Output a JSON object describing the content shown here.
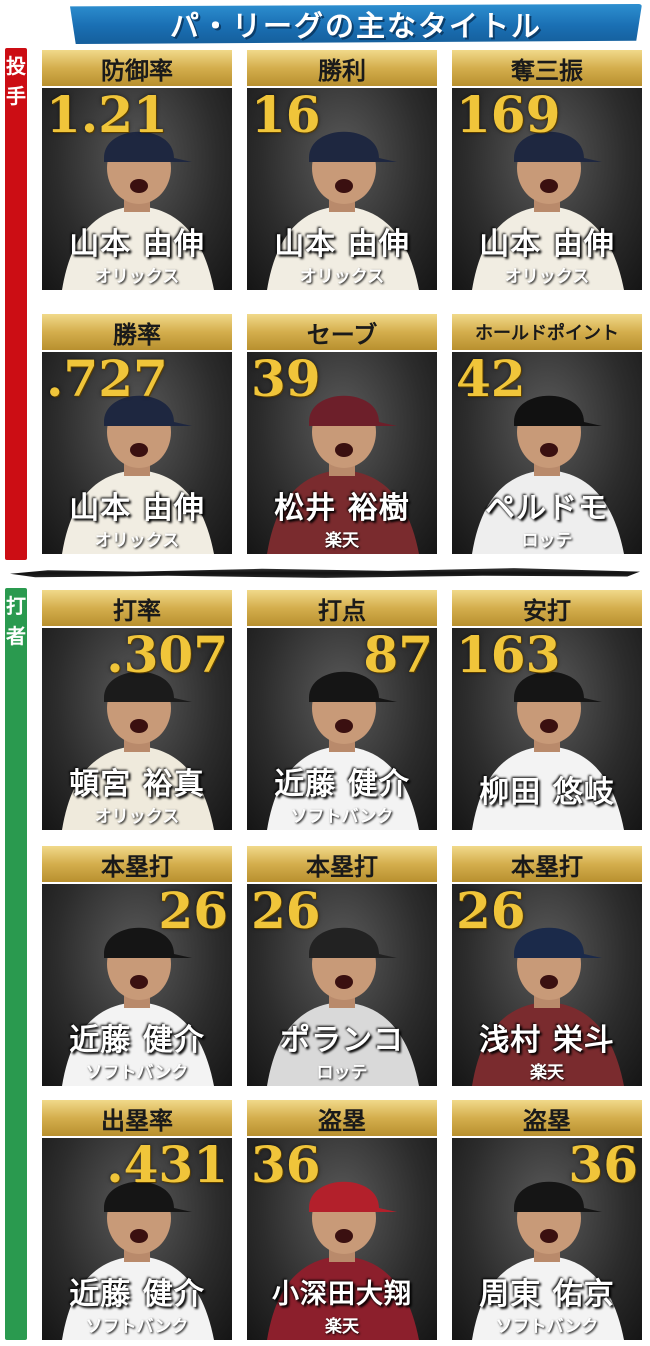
{
  "header": {
    "title": "パ・リーグの主なタイトル"
  },
  "sections": {
    "pitching_label": "投手",
    "batting_label": "打者"
  },
  "cards": [
    {
      "title": "防御率",
      "stat": "1.21",
      "name": "山本 由伸",
      "team": "オリックス",
      "uniform": "#f1ede2",
      "cap": "#1e2740",
      "stat_side": "l"
    },
    {
      "title": "勝利",
      "stat": "16",
      "name": "山本 由伸",
      "team": "オリックス",
      "uniform": "#f1ede2",
      "cap": "#1e2740",
      "stat_side": "l"
    },
    {
      "title": "奪三振",
      "stat": "169",
      "name": "山本 由伸",
      "team": "オリックス",
      "uniform": "#f1ede2",
      "cap": "#1e2740",
      "stat_side": "l"
    },
    {
      "title": "勝率",
      "stat": ".727",
      "name": "山本 由伸",
      "team": "オリックス",
      "uniform": "#f1ede2",
      "cap": "#1e2740",
      "stat_side": "l"
    },
    {
      "title": "セーブ",
      "stat": "39",
      "name": "松井 裕樹",
      "team": "楽天",
      "uniform": "#7a2b2e",
      "cap": "#6d1f2a",
      "stat_side": "l"
    },
    {
      "title": "ホールドポイント",
      "stat": "42",
      "name": "ペルドモ",
      "team": "ロッテ",
      "uniform": "#eeeeee",
      "cap": "#111111",
      "stat_side": "l"
    },
    {
      "title": "打率",
      "stat": ".307",
      "name": "頓宮 裕真",
      "team": "オリックス",
      "uniform": "#efeadc",
      "cap": "#1b1b1b",
      "stat_side": "r"
    },
    {
      "title": "打点",
      "stat": "87",
      "name": "近藤 健介",
      "team": "ソフトバンク",
      "uniform": "#f3f3f3",
      "cap": "#151515",
      "stat_side": "r"
    },
    {
      "title": "安打",
      "stat": "163",
      "name": "柳田 悠岐",
      "team": "",
      "uniform": "#f3f3f3",
      "cap": "#151515",
      "stat_side": "l"
    },
    {
      "title": "本塁打",
      "stat": "26",
      "name": "近藤 健介",
      "team": "ソフトバンク",
      "uniform": "#f3f3f3",
      "cap": "#151515",
      "stat_side": "r"
    },
    {
      "title": "本塁打",
      "stat": "26",
      "name": "ポランコ",
      "team": "ロッテ",
      "uniform": "#d9d9d9",
      "cap": "#222222",
      "stat_side": "l"
    },
    {
      "title": "本塁打",
      "stat": "26",
      "name": "浅村 栄斗",
      "team": "楽天",
      "uniform": "#7a2b2e",
      "cap": "#1b2a4a",
      "stat_side": "l"
    },
    {
      "title": "出塁率",
      "stat": ".431",
      "name": "近藤 健介",
      "team": "ソフトバンク",
      "uniform": "#f3f3f3",
      "cap": "#151515",
      "stat_side": "r"
    },
    {
      "title": "盗塁",
      "stat": "36",
      "name": "小深田大翔",
      "team": "楽天",
      "uniform": "#8c1f2c",
      "cap": "#b3202b",
      "stat_side": "l"
    },
    {
      "title": "盗塁",
      "stat": "36",
      "name": "周東 佑京",
      "team": "ソフトバンク",
      "uniform": "#f3f3f3",
      "cap": "#151515",
      "stat_side": "r"
    }
  ]
}
